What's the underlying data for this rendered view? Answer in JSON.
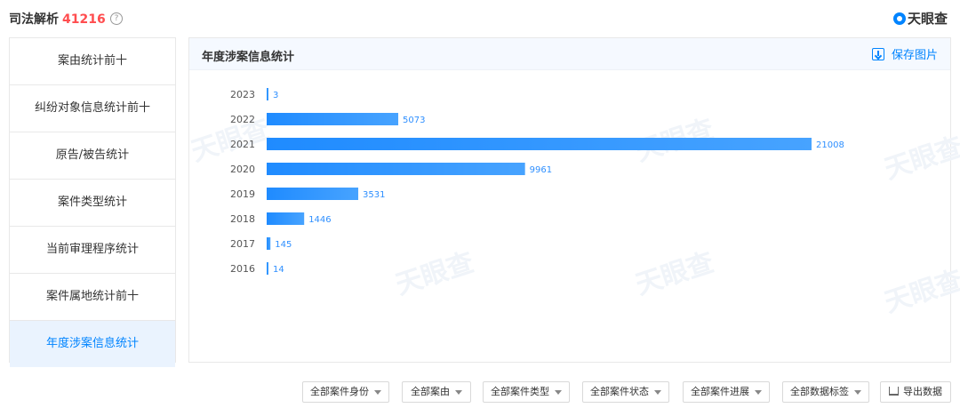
{
  "header": {
    "title": "司法解析",
    "count": "41216",
    "help_icon": "help-circle-icon",
    "brand": "天眼查"
  },
  "sidebar": {
    "items": [
      {
        "label": "案由统计前十"
      },
      {
        "label": "纠纷对象信息统计前十"
      },
      {
        "label": "原告/被告统计"
      },
      {
        "label": "案件类型统计"
      },
      {
        "label": "当前审理程序统计"
      },
      {
        "label": "案件属地统计前十"
      },
      {
        "label": "年度涉案信息统计",
        "active": true
      }
    ]
  },
  "panel": {
    "title": "年度涉案信息统计",
    "save_label": "保存图片",
    "watermark": "天眼查"
  },
  "chart_data": {
    "type": "bar",
    "orientation": "horizontal",
    "categories": [
      "2023",
      "2022",
      "2021",
      "2020",
      "2019",
      "2018",
      "2017",
      "2016"
    ],
    "values": [
      3,
      5073,
      21008,
      9961,
      3531,
      1446,
      145,
      14
    ],
    "bar_color": "#2e8fff",
    "grid": false,
    "legend": "none"
  },
  "filters": [
    {
      "label": "全部案件身份"
    },
    {
      "label": "全部案由"
    },
    {
      "label": "全部案件类型"
    },
    {
      "label": "全部案件状态"
    },
    {
      "label": "全部案件进展"
    },
    {
      "label": "全部数据标签"
    }
  ],
  "export_label": "导出数据",
  "colors": {
    "accent": "#0084ff",
    "count": "#ff4d4f",
    "active_bg": "#eaf3fe"
  }
}
